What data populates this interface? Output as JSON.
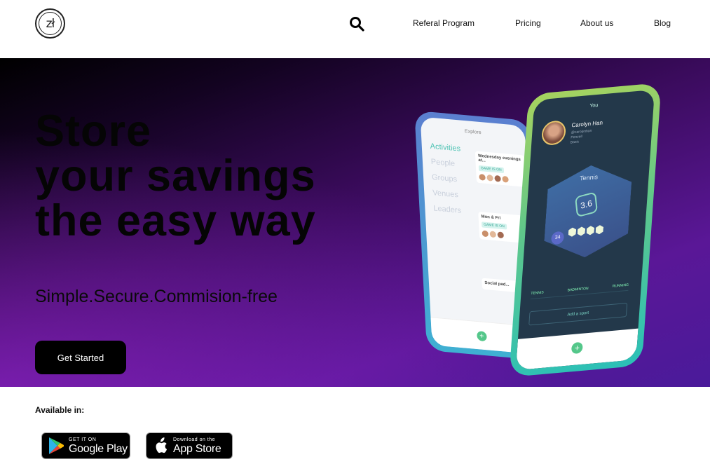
{
  "header": {
    "logo_text": "zł",
    "nav": [
      {
        "label": "Referal Program"
      },
      {
        "label": "Pricing"
      },
      {
        "label": "About us"
      },
      {
        "label": "Blog"
      }
    ]
  },
  "hero": {
    "headline": [
      "Store",
      "your savings",
      "the easy way"
    ],
    "subhead": "Simple.Secure.Commision-free",
    "cta_label": "Get Started"
  },
  "phone_left": {
    "title": "Explore",
    "menu": [
      "Activities",
      "People",
      "Groups",
      "Venues",
      "Leaders"
    ],
    "cards": [
      {
        "heading": "Wednesday evenings at...",
        "tag": "GAME IS ON"
      },
      {
        "heading": "Mon & Fri",
        "tag": "GAME IS ON"
      },
      {
        "heading": "Social pad..."
      }
    ]
  },
  "phone_right": {
    "title": "You",
    "name": "Carolyn Han",
    "meta": [
      "@carolynhan",
      "Penzell",
      "Basic"
    ],
    "sport": "Tennis",
    "score": "3.6",
    "activities_count": "34",
    "tabs": [
      "TENNIS",
      "BADMINTON",
      "RUNNING"
    ],
    "add_sport": "Add a sport"
  },
  "availability": {
    "label": "Available in:",
    "google_play": {
      "small": "GET IT ON",
      "big": "Google Play"
    },
    "app_store": {
      "small": "Download on the",
      "big": "App Store"
    }
  },
  "colors": {
    "accent_teal": "#4fc3b4",
    "button_bg": "#000000",
    "hero_purple": "#5a1797"
  }
}
